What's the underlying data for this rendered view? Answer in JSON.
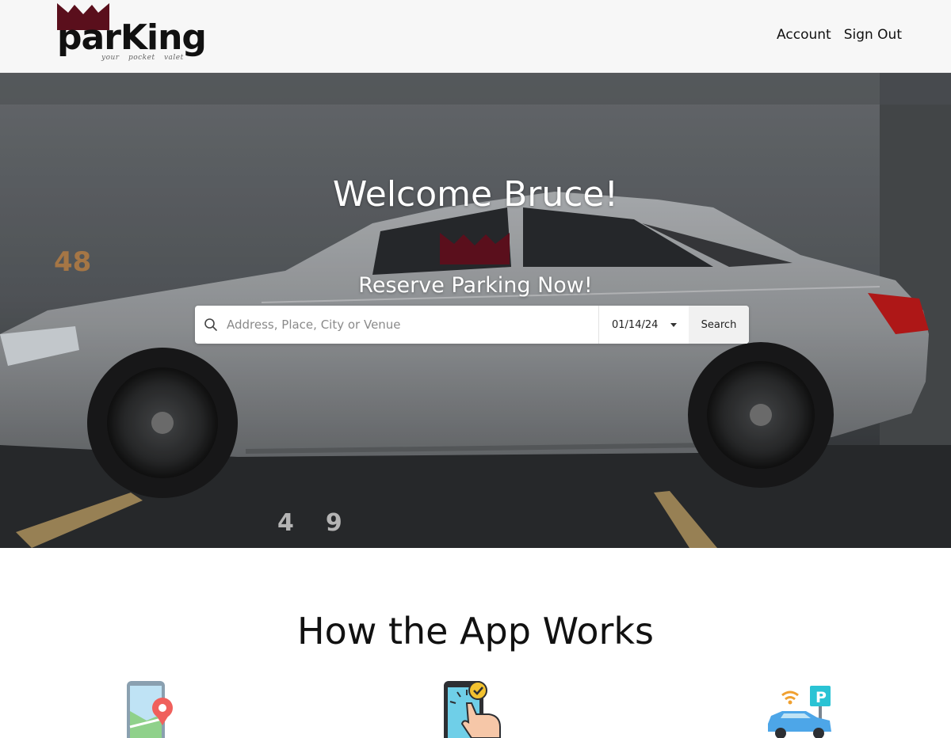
{
  "header": {
    "logo_text": "parKing",
    "logo_tagline": "your pocket valet",
    "nav": [
      {
        "label": "Account"
      },
      {
        "label": "Sign Out"
      }
    ]
  },
  "hero": {
    "title": "Welcome Bruce!",
    "subtitle": "Reserve Parking Now!",
    "search": {
      "placeholder": "Address, Place, City or Venue",
      "date": "01/14/24",
      "button_label": "Search"
    }
  },
  "how_it_works": {
    "title": "How the App Works",
    "icons": [
      "map-location-icon",
      "phone-tap-icon",
      "car-parking-icon"
    ]
  },
  "colors": {
    "brand": "#5a0f1c",
    "header_bg": "#f7f7f7",
    "text": "#111111"
  }
}
